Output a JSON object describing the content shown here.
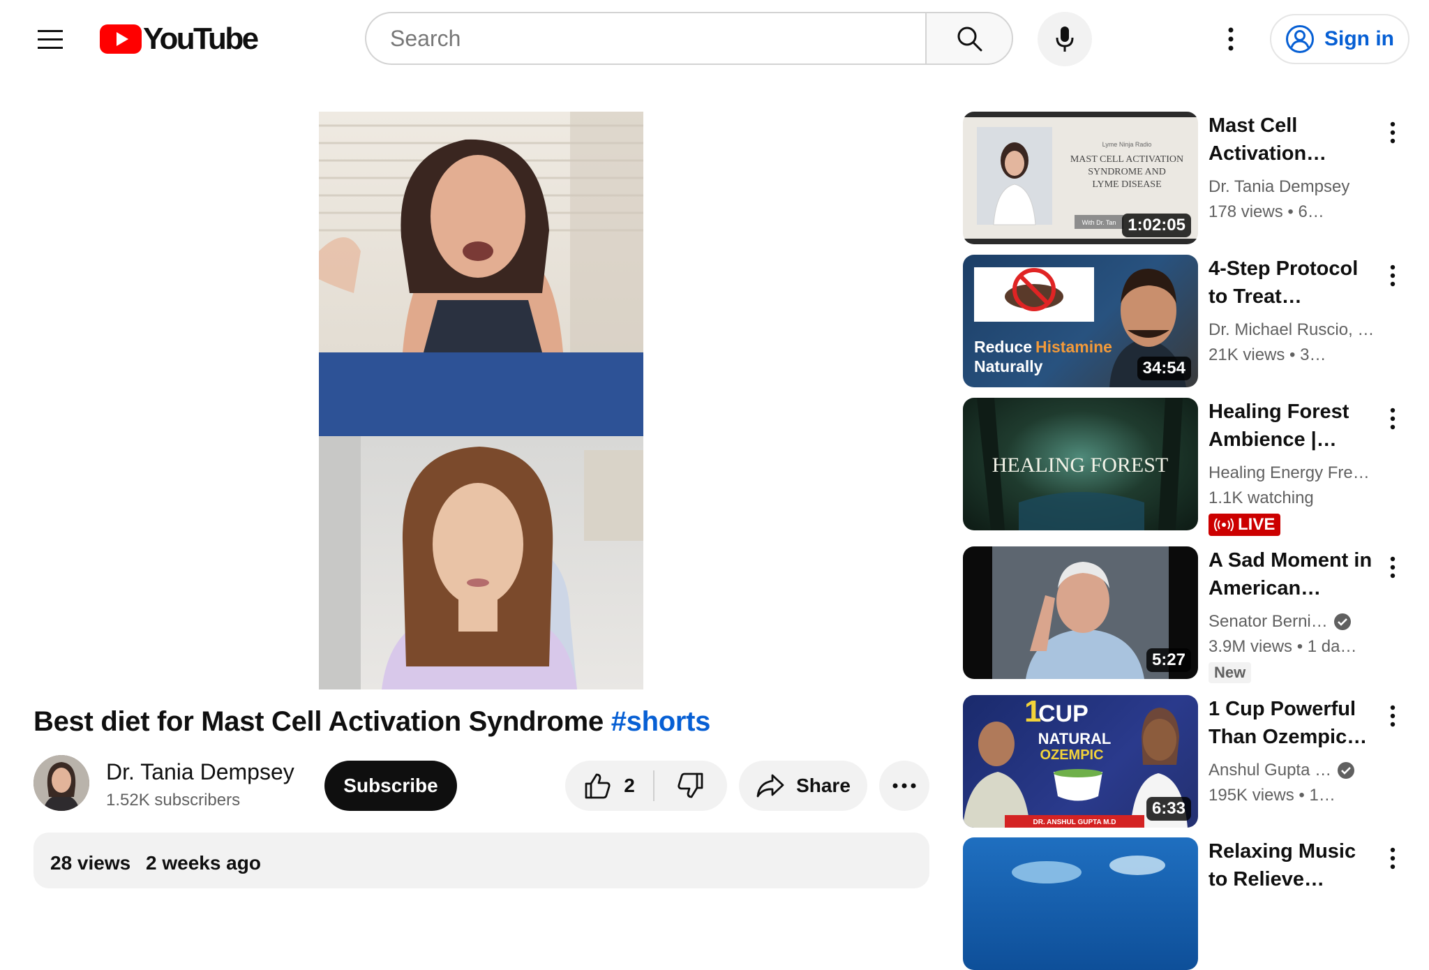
{
  "header": {
    "logo_text": "YouTube",
    "search_placeholder": "Search",
    "sign_in_label": "Sign in"
  },
  "video": {
    "title": "Best diet for Mast Cell Activation Syndrome",
    "hashtag": "#shorts",
    "channel_name": "Dr. Tania Dempsey",
    "subscribers": "1.52K subscribers",
    "subscribe_label": "Subscribe",
    "likes": "2",
    "share_label": "Share",
    "views": "28 views",
    "posted": "2 weeks ago"
  },
  "recommendations": [
    {
      "title": "Mast Cell Activation…",
      "channel": "Dr. Tania Dempsey",
      "meta": "178 views • 6…",
      "duration": "1:02:05",
      "verified": false,
      "thumb_lines": {
        "small": "Lyme Ninja Radio",
        "line1": "MAST CELL ACTIVATION",
        "line2": "SYNDROME AND",
        "line3": "LYME DISEASE",
        "with": "With Dr. Tan"
      }
    },
    {
      "title": "4-Step Protocol to Treat…",
      "channel": "Dr. Michael Ruscio, …",
      "meta": "21K views • 3…",
      "duration": "34:54",
      "verified": false,
      "thumb_lines": {
        "reduce": "Reduce",
        "histamine": "Histamine",
        "naturally": "Naturally"
      }
    },
    {
      "title": "Healing Forest Ambience |…",
      "channel": "Healing Energy Fre…",
      "meta": "1.1K watching",
      "live_label": "LIVE",
      "verified": false,
      "thumb_lines": {
        "text": "HEALING FOREST"
      }
    },
    {
      "title": "A Sad Moment in American History",
      "channel": "Senator Berni…",
      "meta": "3.9M views • 1 da…",
      "badge": "New",
      "duration": "5:27",
      "verified": true
    },
    {
      "title": "1 Cup Powerful Than Ozempic…",
      "channel": "Anshul Gupta …",
      "meta": "195K views • 1…",
      "duration": "6:33",
      "verified": true,
      "thumb_lines": {
        "one": "1",
        "cup": "CUP",
        "natural": "NATURAL",
        "ozempic": "OZEMPIC",
        "doctor": "DR. ANSHUL GUPTA M.D"
      }
    },
    {
      "title": "Relaxing Music to Relieve Stress…",
      "channel": "",
      "meta": "",
      "verified": false
    }
  ],
  "colors": {
    "brand_red": "#ff0000",
    "link_blue": "#065fd4",
    "live_red": "#cc0000"
  }
}
